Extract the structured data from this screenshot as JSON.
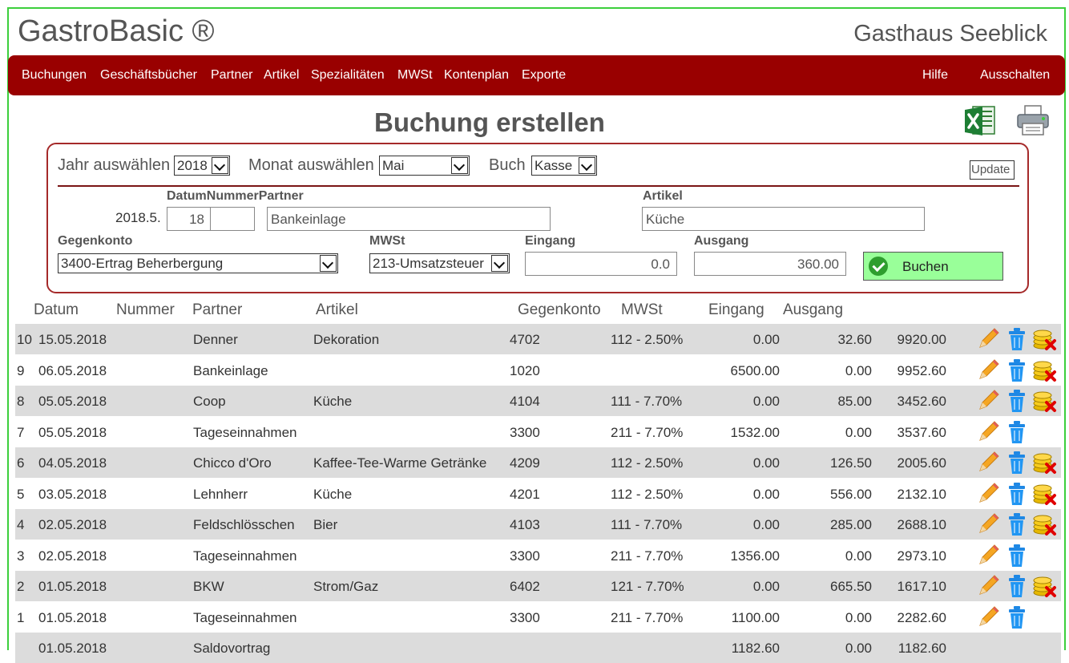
{
  "app": {
    "title": "GastroBasic ®",
    "business": "Gasthaus Seeblick"
  },
  "nav": {
    "items": [
      "Buchungen",
      "Geschäftsbücher",
      "Partner",
      "Artikel",
      "Spezialitäten",
      "MWSt",
      "Kontenplan",
      "Exporte"
    ],
    "help": "Hilfe",
    "logout": "Ausschalten"
  },
  "page": {
    "title": "Buchung erstellen",
    "export_icon": "excel-icon",
    "print_icon": "printer-icon"
  },
  "filters": {
    "year_label": "Jahr auswählen",
    "year_value": "2018",
    "month_label": "Monat auswählen",
    "month_value": "Mai",
    "book_label": "Buch",
    "book_value": "Kasse",
    "update_label": "Update"
  },
  "form": {
    "header_label": "DatumNummerPartner",
    "date_prefix": "2018.5.",
    "day_value": "18",
    "number_value": "",
    "partner_value": "Bankeinlage",
    "article_label": "Artikel",
    "article_value": "Küche",
    "account_label": "Gegenkonto",
    "account_value": "3400-Ertrag Beherbergung",
    "vat_label": "MWSt",
    "vat_value": "213-Umsatzsteuer",
    "income_label": "Eingang",
    "income_value": "0.0",
    "expense_label": "Ausgang",
    "expense_value": "360.00",
    "submit_label": "Buchen"
  },
  "table": {
    "headers": [
      "Datum",
      "Nummer",
      "Partner",
      "Artikel",
      "Gegenkonto",
      "MWSt",
      "Eingang",
      "Ausgang"
    ],
    "rows": [
      {
        "id": "10",
        "date": "15.05.2018",
        "partner": "Denner",
        "article": "Dekoration",
        "account": "4702",
        "vat": "112 - 2.50%",
        "income": "0.00",
        "expense": "32.60",
        "balance": "9920.00",
        "delete_coins": true
      },
      {
        "id": "9",
        "date": "06.05.2018",
        "partner": "Bankeinlage",
        "article": "",
        "account": "1020",
        "vat": "",
        "income": "6500.00",
        "expense": "0.00",
        "balance": "9952.60",
        "delete_coins": true
      },
      {
        "id": "8",
        "date": "05.05.2018",
        "partner": "Coop",
        "article": "Küche",
        "account": "4104",
        "vat": "111 - 7.70%",
        "income": "0.00",
        "expense": "85.00",
        "balance": "3452.60",
        "delete_coins": true
      },
      {
        "id": "7",
        "date": "05.05.2018",
        "partner": "Tageseinnahmen",
        "article": "",
        "account": "3300",
        "vat": "211 - 7.70%",
        "income": "1532.00",
        "expense": "0.00",
        "balance": "3537.60",
        "delete_coins": false
      },
      {
        "id": "6",
        "date": "04.05.2018",
        "partner": "Chicco d'Oro",
        "article": "Kaffee-Tee-Warme Getränke",
        "account": "4209",
        "vat": "112 - 2.50%",
        "income": "0.00",
        "expense": "126.50",
        "balance": "2005.60",
        "delete_coins": true
      },
      {
        "id": "5",
        "date": "03.05.2018",
        "partner": "Lehnherr",
        "article": "Küche",
        "account": "4201",
        "vat": "112 - 2.50%",
        "income": "0.00",
        "expense": "556.00",
        "balance": "2132.10",
        "delete_coins": true
      },
      {
        "id": "4",
        "date": "02.05.2018",
        "partner": "Feldschlösschen",
        "article": "Bier",
        "account": "4103",
        "vat": "111 - 7.70%",
        "income": "0.00",
        "expense": "285.00",
        "balance": "2688.10",
        "delete_coins": true
      },
      {
        "id": "3",
        "date": "02.05.2018",
        "partner": "Tageseinnahmen",
        "article": "",
        "account": "3300",
        "vat": "211 - 7.70%",
        "income": "1356.00",
        "expense": "0.00",
        "balance": "2973.10",
        "delete_coins": false
      },
      {
        "id": "2",
        "date": "01.05.2018",
        "partner": "BKW",
        "article": "Strom/Gaz",
        "account": "6402",
        "vat": "121 - 7.70%",
        "income": "0.00",
        "expense": "665.50",
        "balance": "1617.10",
        "delete_coins": true
      },
      {
        "id": "1",
        "date": "01.05.2018",
        "partner": "Tageseinnahmen",
        "article": "",
        "account": "3300",
        "vat": "211 - 7.70%",
        "income": "1100.00",
        "expense": "0.00",
        "balance": "2282.60",
        "delete_coins": false
      },
      {
        "id": "",
        "date": "01.05.2018",
        "partner": "Saldovortrag",
        "article": "",
        "account": "",
        "vat": "",
        "income": "1182.60",
        "expense": "0.00",
        "balance": "1182.60",
        "delete_coins": false,
        "no_actions": true
      }
    ]
  },
  "colors": {
    "nav_bg": "#990000",
    "panel_border": "#a52a2a",
    "row_shade": "#dcdcdc",
    "submit_bg": "#99ff99",
    "frame": "#3ccf3c"
  }
}
